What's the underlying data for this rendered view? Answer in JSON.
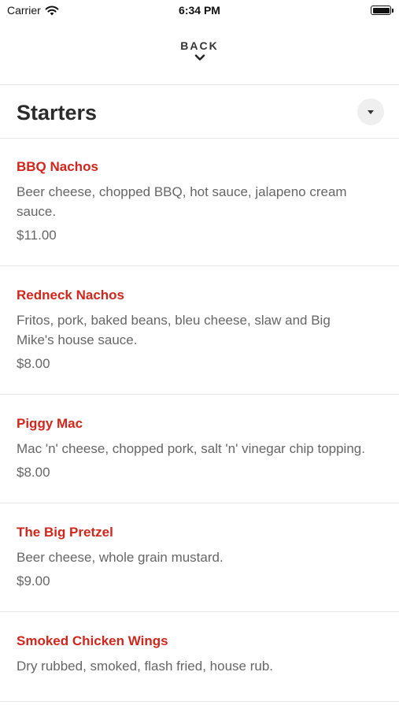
{
  "status_bar": {
    "carrier": "Carrier",
    "time": "6:34 PM"
  },
  "nav": {
    "back_label": "BACK"
  },
  "section": {
    "title": "Starters"
  },
  "menu_items": [
    {
      "name": "BBQ Nachos",
      "description": "Beer cheese, chopped BBQ, hot sauce, jalapeno cream sauce.",
      "price": "$11.00"
    },
    {
      "name": "Redneck Nachos",
      "description": "Fritos, pork, baked beans, bleu cheese, slaw and Big Mike's house sauce.",
      "price": "$8.00"
    },
    {
      "name": "Piggy Mac",
      "description": "Mac 'n' cheese, chopped pork, salt 'n' vinegar chip topping.",
      "price": "$8.00"
    },
    {
      "name": "The Big Pretzel",
      "description": "Beer cheese, whole grain mustard.",
      "price": "$9.00"
    },
    {
      "name": "Smoked Chicken Wings",
      "description": "Dry rubbed, smoked, flash fried, house rub.",
      "price": ""
    }
  ],
  "colors": {
    "item_name": "#d0261c",
    "body_text": "#666666",
    "divider": "#e6e6e6"
  },
  "icons": {
    "back": "chevron-down-icon",
    "section_toggle": "caret-down-icon",
    "wifi": "wifi-icon",
    "battery": "battery-icon"
  }
}
